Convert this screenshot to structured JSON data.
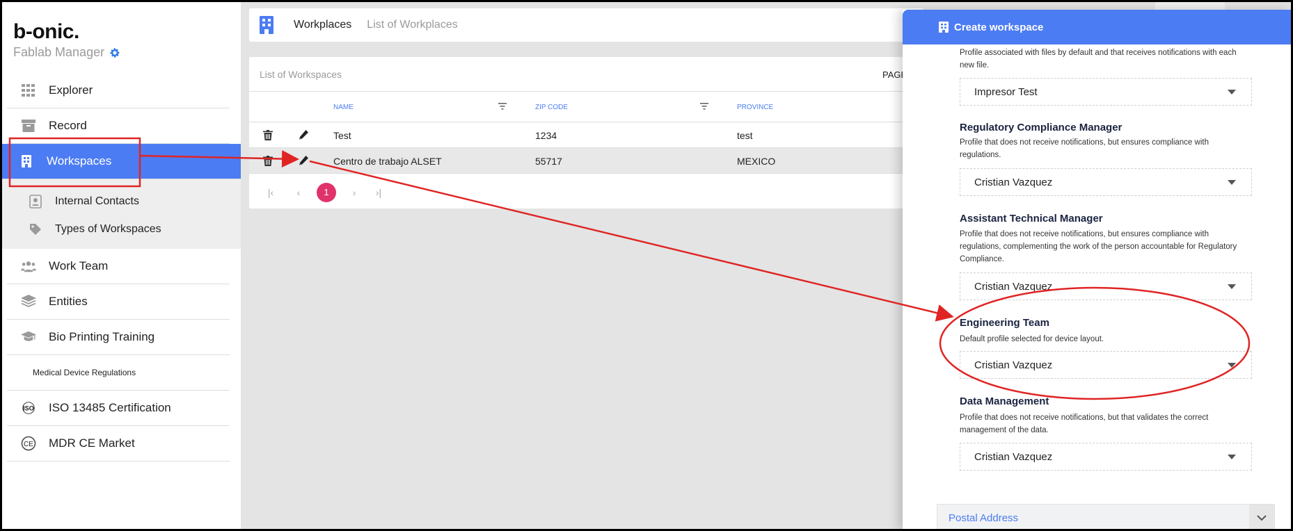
{
  "sidebar": {
    "logo": "b-onic.",
    "subtitle": "Fablab Manager",
    "items": [
      {
        "label": "Explorer",
        "icon": "grid-icon"
      },
      {
        "label": "Record",
        "icon": "archive-icon"
      },
      {
        "label": "Workspaces",
        "icon": "building-icon"
      }
    ],
    "sub_items": [
      {
        "label": "Internal Contacts",
        "icon": "contact-card-icon"
      },
      {
        "label": "Types of Workspaces",
        "icon": "tag-icon"
      }
    ],
    "items2": [
      {
        "label": "Work Team",
        "icon": "team-icon"
      },
      {
        "label": "Entities",
        "icon": "layers-icon"
      },
      {
        "label": "Bio Printing Training",
        "icon": "graduation-cap-icon"
      }
    ],
    "section_label": "Medical Device Regulations",
    "items3": [
      {
        "label": "ISO 13485 Certification",
        "icon": "iso-icon"
      },
      {
        "label": "MDR CE Market",
        "icon": "ce-icon"
      }
    ]
  },
  "topbar": {
    "title": "Workplaces",
    "breadcrumb": "List of Workplaces"
  },
  "list": {
    "header": "List of Workspaces",
    "page_label": "PAGE",
    "columns": [
      "NAME",
      "ZIP CODE",
      "PROVINCE"
    ],
    "rows": [
      {
        "name": "Test",
        "zip": "1234",
        "province": "test"
      },
      {
        "name": "Centro de trabajo ALSET",
        "zip": "55717",
        "province": "MEXICO"
      }
    ],
    "pagination": {
      "current": "1",
      "first": "|‹",
      "prev": "‹",
      "next": "›",
      "last": "›|"
    }
  },
  "panel": {
    "title": "Create workspace",
    "sections": [
      {
        "title": "",
        "desc": "Profile associated with files by default and that receives notifications with each new file.",
        "value": "Impresor Test"
      },
      {
        "title": "Regulatory Compliance Manager",
        "desc": "Profile that does not receive notifications, but ensures compliance with regulations.",
        "value": "Cristian Vazquez"
      },
      {
        "title": "Assistant Technical Manager",
        "desc": "Profile that does not receive notifications, but ensures compliance with regulations, complementing the work of the person accountable for Regulatory Compliance.",
        "value": "Cristian Vazquez"
      },
      {
        "title": "Engineering Team",
        "desc": "Default profile selected for device layout.",
        "value": "Cristian Vazquez"
      },
      {
        "title": "Data Management",
        "desc": "Profile that does not receive notifications, but that validates the correct management of the data.",
        "value": "Cristian Vazquez"
      }
    ],
    "postal_address": "Postal Address"
  },
  "colors": {
    "accent": "#4c7cf3",
    "page_badge": "#e0336b",
    "annotation": "#e02424"
  }
}
